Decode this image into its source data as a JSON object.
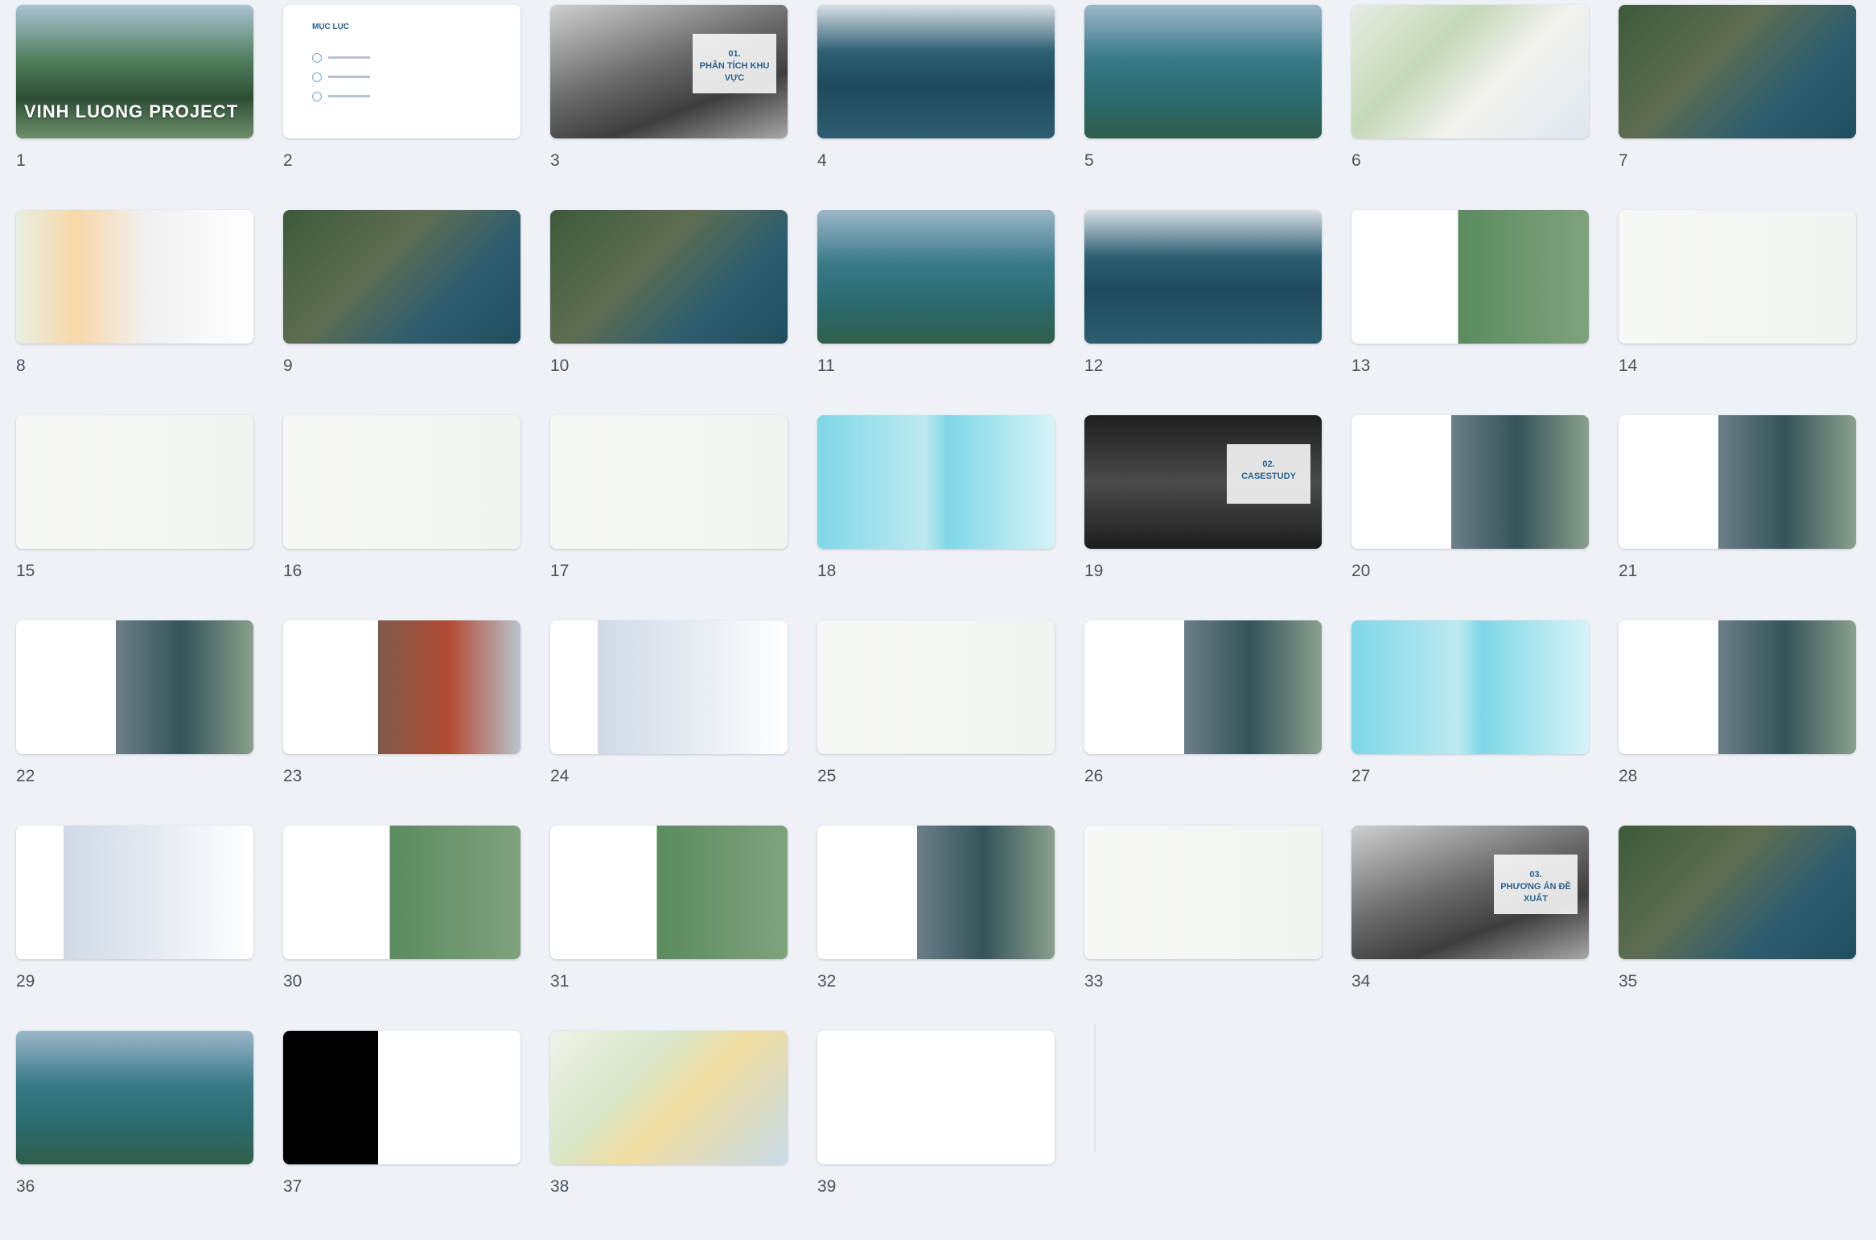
{
  "slides": [
    {
      "n": "1",
      "style": "t-photo",
      "title": "VINH LUONG PROJECT"
    },
    {
      "n": "2",
      "style": "t-white",
      "heading": "MỤC LỤC"
    },
    {
      "n": "3",
      "style": "t-gray",
      "overlay": "01.\nPHÂN TÍCH KHU VỰC"
    },
    {
      "n": "4",
      "style": "t-sea"
    },
    {
      "n": "5",
      "style": "t-sea2"
    },
    {
      "n": "6",
      "style": "t-map"
    },
    {
      "n": "7",
      "style": "t-aerial"
    },
    {
      "n": "8",
      "style": "t-color"
    },
    {
      "n": "9",
      "style": "t-aerial"
    },
    {
      "n": "10",
      "style": "t-aerial"
    },
    {
      "n": "11",
      "style": "t-sea2"
    },
    {
      "n": "12",
      "style": "t-sea"
    },
    {
      "n": "13",
      "style": "t-green"
    },
    {
      "n": "14",
      "style": "t-plan"
    },
    {
      "n": "15",
      "style": "t-plan"
    },
    {
      "n": "16",
      "style": "t-plan"
    },
    {
      "n": "17",
      "style": "t-plan"
    },
    {
      "n": "18",
      "style": "t-cyan"
    },
    {
      "n": "19",
      "style": "t-dark",
      "overlay": "02.\nCASESTUDY"
    },
    {
      "n": "20",
      "style": "t-arch"
    },
    {
      "n": "21",
      "style": "t-arch"
    },
    {
      "n": "22",
      "style": "t-arch"
    },
    {
      "n": "23",
      "style": "t-arch2"
    },
    {
      "n": "24",
      "style": "t-arch3"
    },
    {
      "n": "25",
      "style": "t-plan"
    },
    {
      "n": "26",
      "style": "t-arch"
    },
    {
      "n": "27",
      "style": "t-cyan"
    },
    {
      "n": "28",
      "style": "t-arch"
    },
    {
      "n": "29",
      "style": "t-arch3"
    },
    {
      "n": "30",
      "style": "t-green"
    },
    {
      "n": "31",
      "style": "t-green"
    },
    {
      "n": "32",
      "style": "t-arch"
    },
    {
      "n": "33",
      "style": "t-plan"
    },
    {
      "n": "34",
      "style": "t-gray",
      "overlay": "03.\nPHƯƠNG ÁN ĐỀ XUẤT"
    },
    {
      "n": "35",
      "style": "t-aerial"
    },
    {
      "n": "36",
      "style": "t-sea2"
    },
    {
      "n": "37",
      "style": "t-dark2"
    },
    {
      "n": "38",
      "style": "t-beige"
    },
    {
      "n": "39",
      "style": "t-line"
    }
  ]
}
